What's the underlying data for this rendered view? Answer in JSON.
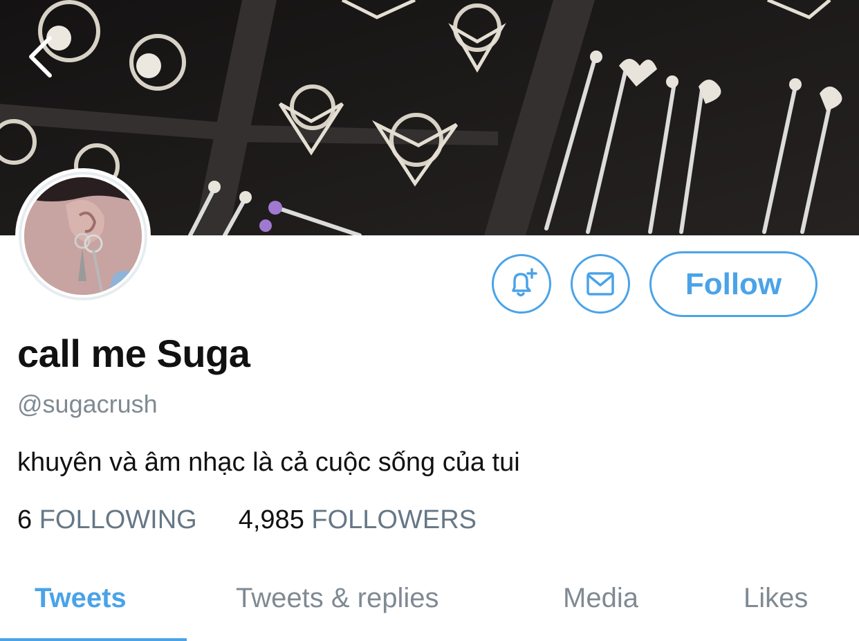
{
  "profile": {
    "display_name": "call me Suga",
    "handle": "@sugacrush",
    "bio": "khuyên và âm nhạc là cả cuộc sống của tui"
  },
  "stats": {
    "following_count": "6",
    "following_label": "FOLLOWING",
    "followers_count": "4,985",
    "followers_label": "FOLLOWERS"
  },
  "actions": {
    "follow_label": "Follow",
    "notify_icon": "bell-plus-icon",
    "message_icon": "envelope-icon",
    "back_icon": "chevron-left-icon"
  },
  "tabs": [
    {
      "label": "Tweets",
      "active": true
    },
    {
      "label": "Tweets & replies",
      "active": false
    },
    {
      "label": "Media",
      "active": false
    },
    {
      "label": "Likes",
      "active": false
    }
  ],
  "colors": {
    "accent": "#4aa3e8",
    "secondary_text": "#7f8a93"
  }
}
